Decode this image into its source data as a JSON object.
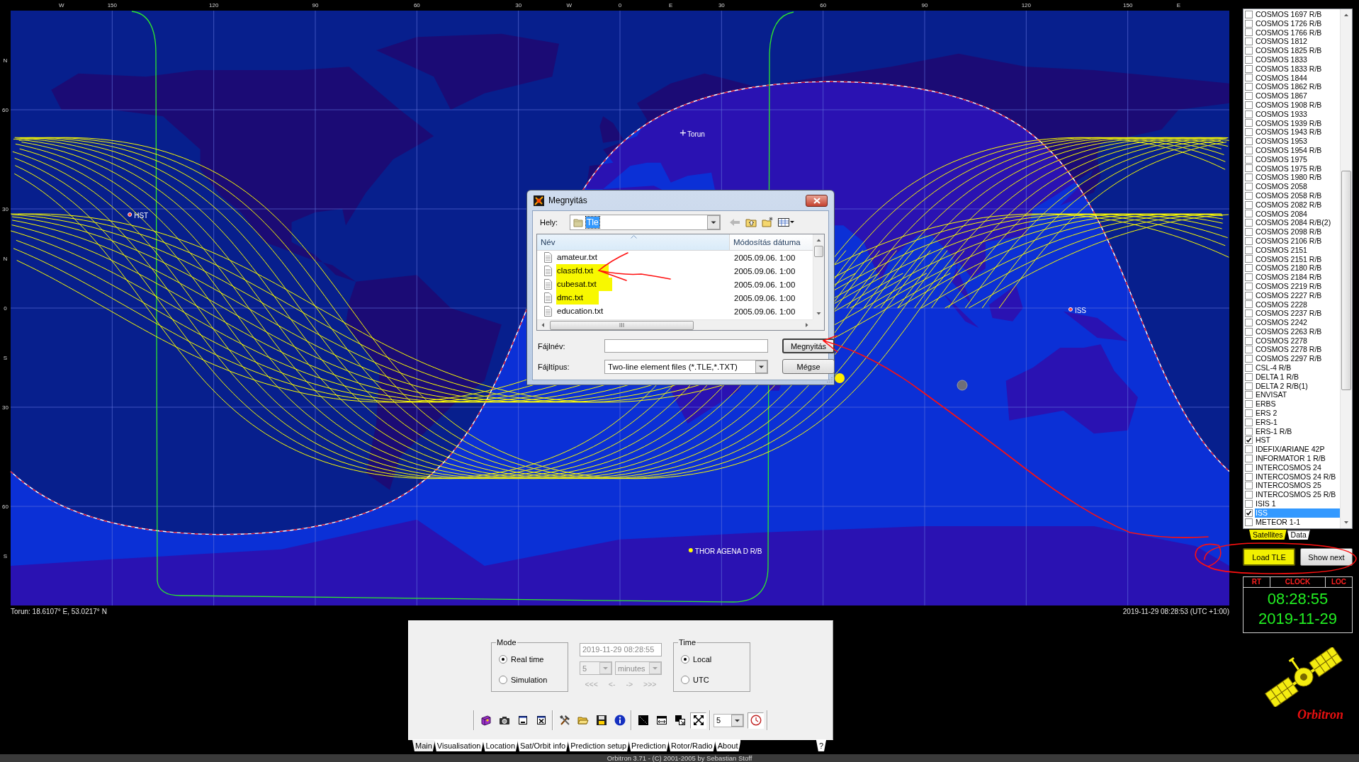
{
  "map": {
    "x_axis_labels": [
      "W",
      "150",
      "120",
      "90",
      "60",
      "30",
      "W",
      "0",
      "E",
      "30",
      "60",
      "90",
      "120",
      "150",
      "E"
    ],
    "y_axis_labels": [
      "N",
      "60",
      "30",
      "N",
      "0",
      "S",
      "30",
      "60",
      "S"
    ],
    "markers": [
      {
        "label": "Torun",
        "kind": "location"
      },
      {
        "label": "HST",
        "kind": "satellite"
      },
      {
        "label": "ISS",
        "kind": "satellite"
      },
      {
        "label": "THOR AGENA D R/B",
        "kind": "visible-satellite"
      }
    ]
  },
  "status_bar": {
    "location": "Torun: 18.6107° E, 53.0217° N",
    "time": "2019-11-29 08:28:53 (UTC +1:00)"
  },
  "dialog": {
    "title": "Megnyitás",
    "location": {
      "label": "Hely:",
      "value": "Tle",
      "value_selected": true
    },
    "columns": [
      "Név",
      "Módosítás dátuma"
    ],
    "files": [
      {
        "name": "amateur.txt",
        "modified": "2005.09.06. 1:00",
        "highlighted": false
      },
      {
        "name": "classfd.txt",
        "modified": "2005.09.06. 1:00",
        "highlighted": true
      },
      {
        "name": "cubesat.txt",
        "modified": "2005.09.06. 1:00",
        "highlighted": true
      },
      {
        "name": "dmc.txt",
        "modified": "2005.09.06. 1:00",
        "highlighted": true
      },
      {
        "name": "education.txt",
        "modified": "2005.09.06. 1:00",
        "highlighted": false
      }
    ],
    "filename_label": "Fájlnév:",
    "filetype_label": "Fájltípus:",
    "filetype_value": "Two-line element files (*.TLE,*.TXT)",
    "buttons": [
      {
        "label": "Megnyitás",
        "kind": "default"
      },
      {
        "label": "Mégse",
        "kind": "normal"
      }
    ]
  },
  "satellites": [
    {
      "name": "COSMOS 1697 R/B",
      "checked": false,
      "selected": false
    },
    {
      "name": "COSMOS 1726 R/B",
      "checked": false,
      "selected": false
    },
    {
      "name": "COSMOS 1766 R/B",
      "checked": false,
      "selected": false
    },
    {
      "name": "COSMOS 1812",
      "checked": false,
      "selected": false
    },
    {
      "name": "COSMOS 1825 R/B",
      "checked": false,
      "selected": false
    },
    {
      "name": "COSMOS 1833",
      "checked": false,
      "selected": false
    },
    {
      "name": "COSMOS 1833 R/B",
      "checked": false,
      "selected": false
    },
    {
      "name": "COSMOS 1844",
      "checked": false,
      "selected": false
    },
    {
      "name": "COSMOS 1862 R/B",
      "checked": false,
      "selected": false
    },
    {
      "name": "COSMOS 1867",
      "checked": false,
      "selected": false
    },
    {
      "name": "COSMOS 1908 R/B",
      "checked": false,
      "selected": false
    },
    {
      "name": "COSMOS 1933",
      "checked": false,
      "selected": false
    },
    {
      "name": "COSMOS 1939 R/B",
      "checked": false,
      "selected": false
    },
    {
      "name": "COSMOS 1943 R/B",
      "checked": false,
      "selected": false
    },
    {
      "name": "COSMOS 1953",
      "checked": false,
      "selected": false
    },
    {
      "name": "COSMOS 1954 R/B",
      "checked": false,
      "selected": false
    },
    {
      "name": "COSMOS 1975",
      "checked": false,
      "selected": false
    },
    {
      "name": "COSMOS 1975 R/B",
      "checked": false,
      "selected": false
    },
    {
      "name": "COSMOS 1980 R/B",
      "checked": false,
      "selected": false
    },
    {
      "name": "COSMOS 2058",
      "checked": false,
      "selected": false
    },
    {
      "name": "COSMOS 2058 R/B",
      "checked": false,
      "selected": false
    },
    {
      "name": "COSMOS 2082 R/B",
      "checked": false,
      "selected": false
    },
    {
      "name": "COSMOS 2084",
      "checked": false,
      "selected": false
    },
    {
      "name": "COSMOS 2084 R/B(2)",
      "checked": false,
      "selected": false
    },
    {
      "name": "COSMOS 2098 R/B",
      "checked": false,
      "selected": false
    },
    {
      "name": "COSMOS 2106 R/B",
      "checked": false,
      "selected": false
    },
    {
      "name": "COSMOS 2151",
      "checked": false,
      "selected": false
    },
    {
      "name": "COSMOS 2151 R/B",
      "checked": false,
      "selected": false
    },
    {
      "name": "COSMOS 2180 R/B",
      "checked": false,
      "selected": false
    },
    {
      "name": "COSMOS 2184 R/B",
      "checked": false,
      "selected": false
    },
    {
      "name": "COSMOS 2219 R/B",
      "checked": false,
      "selected": false
    },
    {
      "name": "COSMOS 2227 R/B",
      "checked": false,
      "selected": false
    },
    {
      "name": "COSMOS 2228",
      "checked": false,
      "selected": false
    },
    {
      "name": "COSMOS 2237 R/B",
      "checked": false,
      "selected": false
    },
    {
      "name": "COSMOS 2242",
      "checked": false,
      "selected": false
    },
    {
      "name": "COSMOS 2263 R/B",
      "checked": false,
      "selected": false
    },
    {
      "name": "COSMOS 2278",
      "checked": false,
      "selected": false
    },
    {
      "name": "COSMOS 2278 R/B",
      "checked": false,
      "selected": false
    },
    {
      "name": "COSMOS 2297 R/B",
      "checked": false,
      "selected": false
    },
    {
      "name": "CSL-4 R/B",
      "checked": false,
      "selected": false
    },
    {
      "name": "DELTA 1 R/B",
      "checked": false,
      "selected": false
    },
    {
      "name": "DELTA 2 R/B(1)",
      "checked": false,
      "selected": false
    },
    {
      "name": "ENVISAT",
      "checked": false,
      "selected": false
    },
    {
      "name": "ERBS",
      "checked": false,
      "selected": false
    },
    {
      "name": "ERS 2",
      "checked": false,
      "selected": false
    },
    {
      "name": "ERS-1",
      "checked": false,
      "selected": false
    },
    {
      "name": "ERS-1 R/B",
      "checked": false,
      "selected": false
    },
    {
      "name": "HST",
      "checked": true,
      "selected": false
    },
    {
      "name": "IDEFIX/ARIANE 42P",
      "checked": false,
      "selected": false
    },
    {
      "name": "INFORMATOR 1 R/B",
      "checked": false,
      "selected": false
    },
    {
      "name": "INTERCOSMOS 24",
      "checked": false,
      "selected": false
    },
    {
      "name": "INTERCOSMOS 24 R/B",
      "checked": false,
      "selected": false
    },
    {
      "name": "INTERCOSMOS 25",
      "checked": false,
      "selected": false
    },
    {
      "name": "INTERCOSMOS 25 R/B",
      "checked": false,
      "selected": false
    },
    {
      "name": "ISIS 1",
      "checked": false,
      "selected": false
    },
    {
      "name": "ISS",
      "checked": true,
      "selected": true
    },
    {
      "name": "METEOR 1-1",
      "checked": false,
      "selected": false
    }
  ],
  "sidebar_tabs": [
    {
      "label": "Satellites",
      "selected": true,
      "highlighted": true
    },
    {
      "label": "Data",
      "selected": false,
      "highlighted": false
    }
  ],
  "sidebar_buttons": [
    {
      "label": "Load TLE",
      "highlighted": true
    },
    {
      "label": "Show next",
      "highlighted": false
    }
  ],
  "clock": {
    "headers": [
      "RT",
      "CLOCK",
      "LOC"
    ],
    "time": "08:28:55",
    "date": "2019-11-29"
  },
  "logo_text": "Orbitron",
  "control_panel": {
    "mode": {
      "title": "Mode",
      "options": [
        {
          "label": "Real time",
          "selected": true
        },
        {
          "label": "Simulation",
          "selected": false
        }
      ]
    },
    "simulation_disabled": true,
    "datetime": "2019-11-29 08:28:55",
    "step_value": "5",
    "step_unit": "minutes",
    "step_buttons": [
      "<<<",
      "<-",
      "->",
      ">>>"
    ],
    "time": {
      "title": "Time",
      "options": [
        {
          "label": "Local",
          "selected": true
        },
        {
          "label": "UTC",
          "selected": false
        }
      ]
    },
    "toolbar": [
      {
        "pressed": false
      },
      {
        "pressed": false
      },
      {
        "pressed": false
      },
      {
        "pressed": false
      },
      {
        "pressed": false
      },
      {
        "pressed": false
      },
      {
        "pressed": false
      },
      {
        "pressed": false
      },
      {
        "pressed": false
      },
      {
        "pressed": false
      },
      {
        "pressed": false
      },
      {
        "pressed": true
      },
      {
        "pressed": true
      }
    ],
    "toolbar_value": "5"
  },
  "tabs": [
    {
      "label": "Main",
      "selected": true
    },
    {
      "label": "Visualisation",
      "selected": false
    },
    {
      "label": "Location",
      "selected": false
    },
    {
      "label": "Sat/Orbit info",
      "selected": false
    },
    {
      "label": "Prediction setup",
      "selected": false
    },
    {
      "label": "Prediction",
      "selected": false
    },
    {
      "label": "Rotor/Radio",
      "selected": false
    },
    {
      "label": "About",
      "selected": false
    }
  ],
  "help_label": "?",
  "footer": "Orbitron 3.71 - (C) 2001-2005 by Sebastian Stoff"
}
